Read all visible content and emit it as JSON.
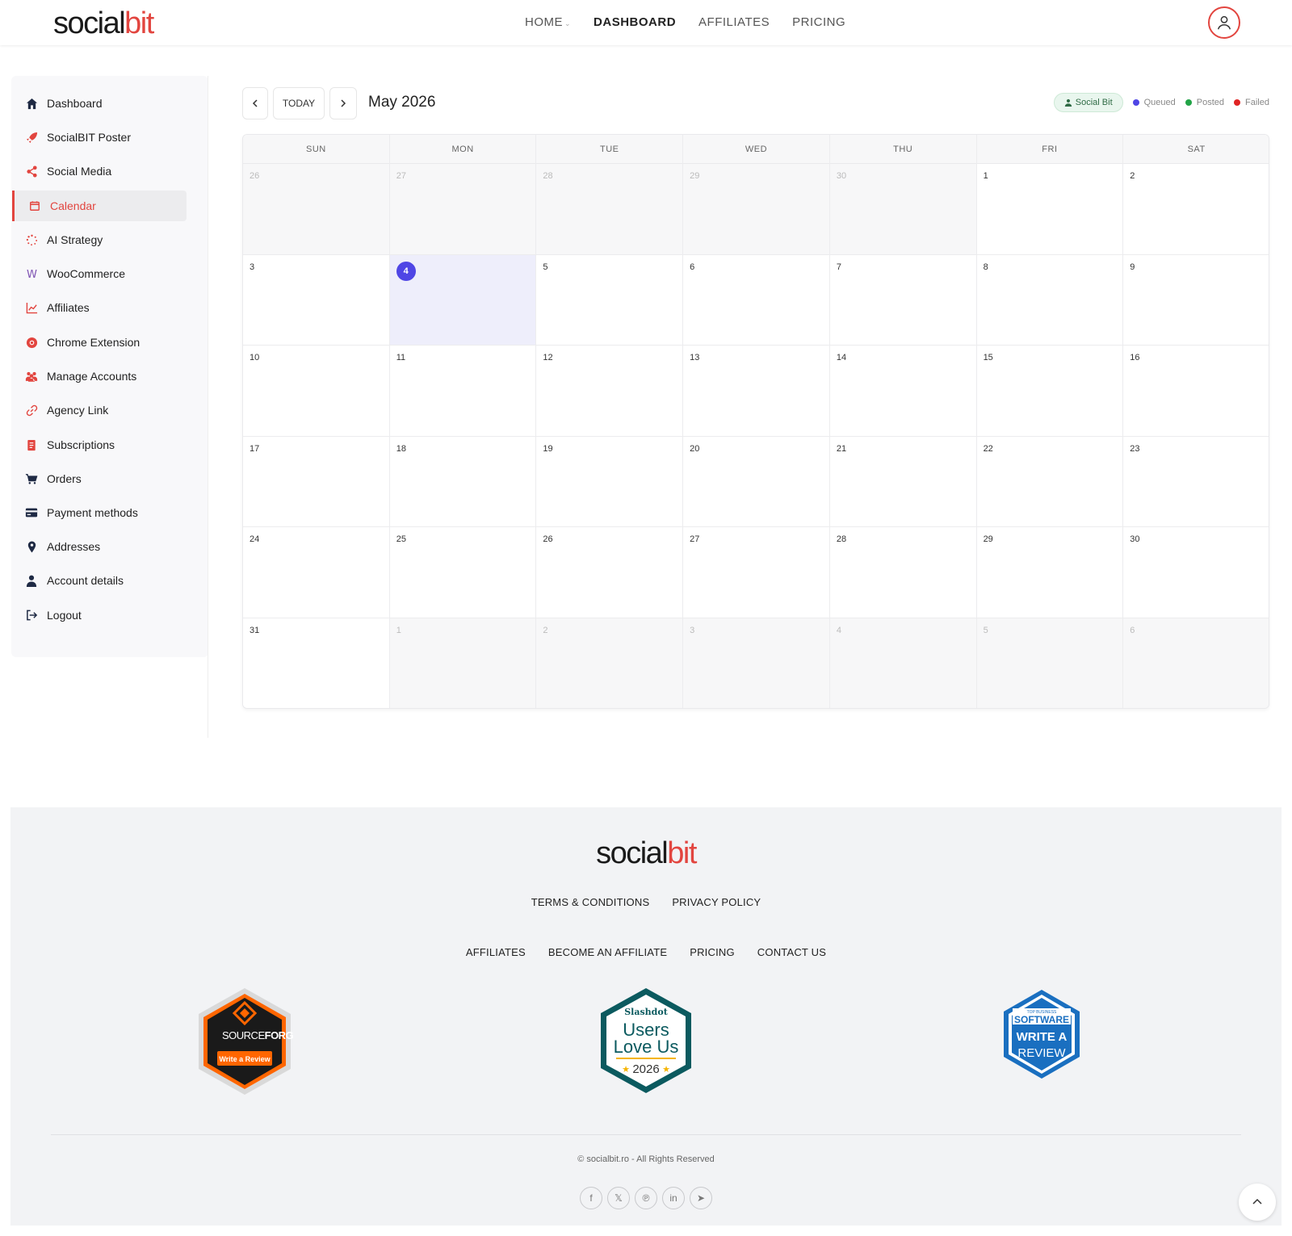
{
  "header": {
    "logo": {
      "part1": "social",
      "part2": "bit"
    },
    "nav": [
      {
        "label": "HOME"
      },
      {
        "label": "DASHBOARD"
      },
      {
        "label": "AFFILIATES"
      },
      {
        "label": "PRICING"
      }
    ]
  },
  "sidebar": {
    "items": [
      {
        "label": "Dashboard",
        "icon": "home-icon"
      },
      {
        "label": "SocialBIT Poster",
        "icon": "rocket-icon"
      },
      {
        "label": "Social Media",
        "icon": "share-icon"
      },
      {
        "label": "Calendar",
        "icon": "calendar-icon"
      },
      {
        "label": "AI Strategy",
        "icon": "spinner-icon"
      },
      {
        "label": "WooCommerce",
        "icon": "woocommerce-icon"
      },
      {
        "label": "Affiliates",
        "icon": "chart-line-icon"
      },
      {
        "label": "Chrome Extension",
        "icon": "chrome-icon"
      },
      {
        "label": "Manage Accounts",
        "icon": "users-icon"
      },
      {
        "label": "Agency Link",
        "icon": "link-icon"
      },
      {
        "label": "Subscriptions",
        "icon": "document-icon"
      },
      {
        "label": "Orders",
        "icon": "cart-icon"
      },
      {
        "label": "Payment methods",
        "icon": "credit-card-icon"
      },
      {
        "label": "Addresses",
        "icon": "map-pin-icon"
      },
      {
        "label": "Account details",
        "icon": "user-icon"
      },
      {
        "label": "Logout",
        "icon": "logout-icon"
      }
    ]
  },
  "calendar": {
    "today_label": "TODAY",
    "title": "May 2026",
    "account_pill": "Social Bit",
    "legend": [
      {
        "label": "Queued",
        "color": "#4f46e5"
      },
      {
        "label": "Posted",
        "color": "#22a447"
      },
      {
        "label": "Failed",
        "color": "#e02424"
      }
    ],
    "days_of_week": [
      "SUN",
      "MON",
      "TUE",
      "WED",
      "THU",
      "FRI",
      "SAT"
    ],
    "weeks": [
      [
        {
          "d": "26",
          "o": true
        },
        {
          "d": "27",
          "o": true
        },
        {
          "d": "28",
          "o": true
        },
        {
          "d": "29",
          "o": true
        },
        {
          "d": "30",
          "o": true
        },
        {
          "d": "1"
        },
        {
          "d": "2"
        }
      ],
      [
        {
          "d": "3"
        },
        {
          "d": "4",
          "today": true
        },
        {
          "d": "5"
        },
        {
          "d": "6"
        },
        {
          "d": "7"
        },
        {
          "d": "8"
        },
        {
          "d": "9"
        }
      ],
      [
        {
          "d": "10"
        },
        {
          "d": "11"
        },
        {
          "d": "12"
        },
        {
          "d": "13"
        },
        {
          "d": "14"
        },
        {
          "d": "15"
        },
        {
          "d": "16"
        }
      ],
      [
        {
          "d": "17"
        },
        {
          "d": "18"
        },
        {
          "d": "19"
        },
        {
          "d": "20"
        },
        {
          "d": "21"
        },
        {
          "d": "22"
        },
        {
          "d": "23"
        }
      ],
      [
        {
          "d": "24"
        },
        {
          "d": "25"
        },
        {
          "d": "26"
        },
        {
          "d": "27"
        },
        {
          "d": "28"
        },
        {
          "d": "29"
        },
        {
          "d": "30"
        }
      ],
      [
        {
          "d": "31"
        },
        {
          "d": "1",
          "o": true
        },
        {
          "d": "2",
          "o": true
        },
        {
          "d": "3",
          "o": true
        },
        {
          "d": "4",
          "o": true
        },
        {
          "d": "5",
          "o": true
        },
        {
          "d": "6",
          "o": true
        }
      ]
    ]
  },
  "footer": {
    "logo": {
      "part1": "social",
      "part2": "bit"
    },
    "links_row1": [
      "TERMS & CONDITIONS",
      "PRIVACY POLICY"
    ],
    "links_row2": [
      "AFFILIATES",
      "BECOME AN AFFILIATE",
      "PRICING",
      "CONTACT US"
    ],
    "badges": {
      "sourceforge": {
        "brand1": "SOURCE",
        "brand2": "FORGE",
        "cta": "Write a Review"
      },
      "slashdot": {
        "brand": "Slashdot",
        "line1": "Users",
        "line2": "Love Us",
        "year": "2026"
      },
      "software": {
        "top": "TOP BUSINESS",
        "brand": "SOFTWARE",
        "line1": "WRITE A",
        "line2": "REVIEW"
      }
    },
    "copyright": "© socialbit.ro - All Rights Reserved",
    "socials": [
      {
        "glyph": "f",
        "icon": "facebook-icon"
      },
      {
        "glyph": "𝕏",
        "icon": "x-icon"
      },
      {
        "glyph": "℗",
        "icon": "pinterest-icon"
      },
      {
        "glyph": "in",
        "icon": "linkedin-icon"
      },
      {
        "glyph": "➤",
        "icon": "telegram-icon"
      }
    ]
  },
  "colors": {
    "brand_red": "#e2453f",
    "today_purple": "#4f46e5"
  }
}
